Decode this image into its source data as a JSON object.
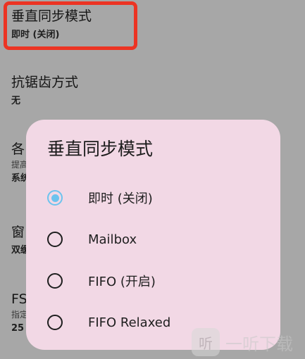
{
  "settings": [
    {
      "title": "垂直同步模式",
      "value": "即时 (关闭)"
    },
    {
      "title": "抗锯齿方式",
      "value": "无"
    },
    {
      "title": "各",
      "summary": "提高",
      "value": "系统"
    },
    {
      "title": "窗",
      "value": "双缓"
    },
    {
      "title": "FS",
      "summary": "指定",
      "value": "25"
    }
  ],
  "dialog": {
    "title": "垂直同步模式",
    "options": [
      {
        "label": "即时 (关闭)",
        "selected": true
      },
      {
        "label": "Mailbox",
        "selected": false
      },
      {
        "label": "FIFO (开启)",
        "selected": false
      },
      {
        "label": "FIFO Relaxed",
        "selected": false
      }
    ]
  },
  "watermark": {
    "badge": "听",
    "text": "一听下载"
  },
  "colors": {
    "scrim": "#a7a7a7",
    "dialog_bg": "#f2d8e5",
    "accent": "#6cc3ee",
    "highlight": "#ec3423"
  }
}
